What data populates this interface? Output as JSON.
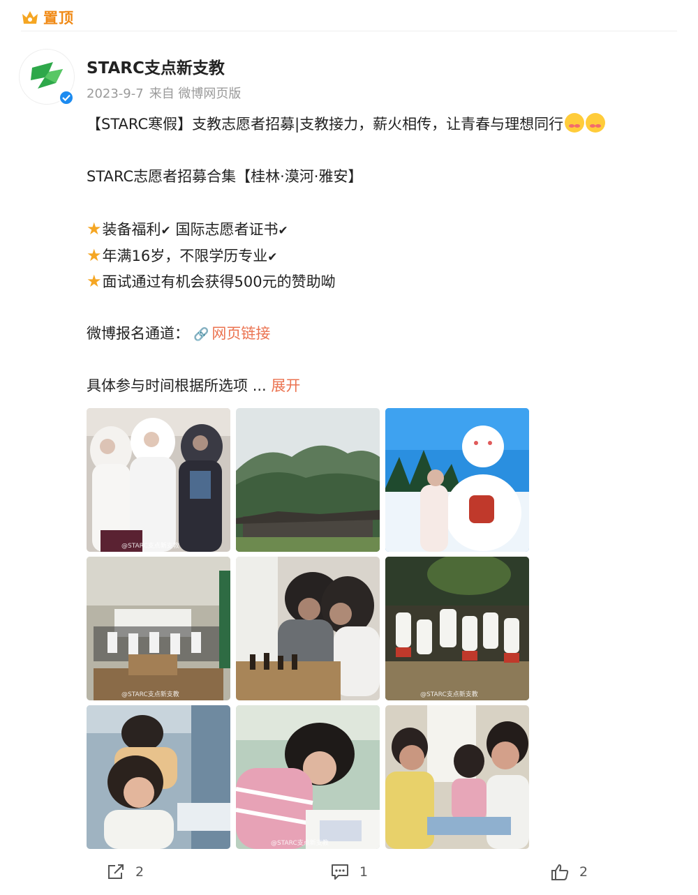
{
  "pin": {
    "label": "置顶"
  },
  "post": {
    "username": "STARC支点新支教",
    "date": "2023-9-7",
    "source": "来自 微博网页版",
    "title_line": "【STARC寒假】支教志愿者招募|支教接力，薪火相传，让青春与理想同行",
    "collection_line": "STARC志愿者招募合集【桂林·漠河·雅安】",
    "perk1_a": "装备福利",
    "perk1_b": "国际志愿者证书",
    "perk2": "年满16岁，不限学历专业",
    "perk3": "面试通过有机会获得500元的赞助呦",
    "signup_label": "微博报名通道：",
    "signup_link": "网页链接",
    "time_line": "具体参与时间根据所选项",
    "ellipsis": "...",
    "expand_label": "展开"
  },
  "photos": [
    {
      "name": "volunteers-winter",
      "watermark": "@STARC支点新支教"
    },
    {
      "name": "mountain-village",
      "watermark": ""
    },
    {
      "name": "snowman",
      "watermark": ""
    },
    {
      "name": "classroom-group",
      "watermark": "@STARC支点新支教"
    },
    {
      "name": "chess-game",
      "watermark": ""
    },
    {
      "name": "kids-night",
      "watermark": "@STARC支点新支教"
    },
    {
      "name": "classroom-boy-girl",
      "watermark": ""
    },
    {
      "name": "girl-writing",
      "watermark": "@STARC支点新支教"
    },
    {
      "name": "girls-classroom",
      "watermark": ""
    }
  ],
  "actions": {
    "share_count": "2",
    "comment_count": "1",
    "like_count": "2"
  },
  "icons": [
    "crown-icon",
    "verified-icon",
    "star-icon",
    "link-icon",
    "share-icon",
    "comment-icon",
    "like-icon"
  ],
  "colors": {
    "accent": "#eb7350",
    "pin": "#f08a16",
    "verified": "#1c8bf0",
    "meta": "#9a9a9a"
  }
}
